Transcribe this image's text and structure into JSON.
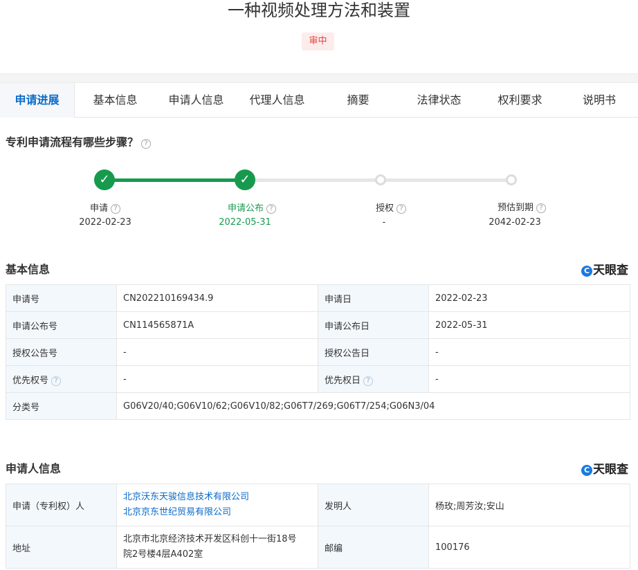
{
  "header": {
    "title": "一种视频处理方法和装置",
    "status": "审中"
  },
  "tabs": [
    "申请进展",
    "基本信息",
    "申请人信息",
    "代理人信息",
    "摘要",
    "法律状态",
    "权利要求",
    "说明书"
  ],
  "progress": {
    "question": "专利申请流程有哪些步骤？",
    "steps": [
      {
        "label": "申请",
        "date": "2022-02-23",
        "done": true
      },
      {
        "label": "申请公布",
        "date": "2022-05-31",
        "done": true
      },
      {
        "label": "授权",
        "date": "-",
        "done": false
      },
      {
        "label": "预估到期",
        "date": "2042-02-23",
        "done": false
      }
    ]
  },
  "basic": {
    "title": "基本信息",
    "brand": "天眼查",
    "rows": [
      {
        "l1": "申请号",
        "v1": "CN202210169434.9",
        "l2": "申请日",
        "v2": "2022-02-23"
      },
      {
        "l1": "申请公布号",
        "v1": "CN114565871A",
        "l2": "申请公布日",
        "v2": "2022-05-31"
      },
      {
        "l1": "授权公告号",
        "v1": "-",
        "l2": "授权公告日",
        "v2": "-"
      },
      {
        "l1": "优先权号",
        "v1": "-",
        "l2": "优先权日",
        "v2": "-"
      }
    ],
    "class_label": "分类号",
    "class_value": "G06V20/40;G06V10/62;G06V10/82;G06T7/269;G06T7/254;G06N3/04"
  },
  "applicant": {
    "title": "申请人信息",
    "brand": "天眼查",
    "applicant_label": "申请（专利权）人",
    "applicants": [
      "北京沃东天骏信息技术有限公司",
      "北京京东世纪贸易有限公司"
    ],
    "inventor_label": "发明人",
    "inventors": "杨玫;周芳汝;安山",
    "address_label": "地址",
    "address_line1": "北京市北京经济技术开发区科创十一街18号",
    "address_line2": "院2号楼4层A402室",
    "postcode_label": "邮编",
    "postcode": "100176"
  }
}
